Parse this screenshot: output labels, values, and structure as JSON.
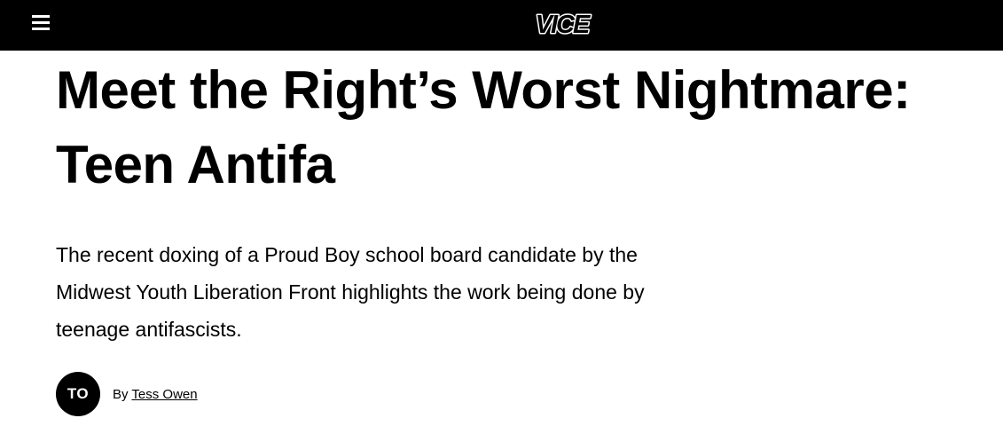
{
  "header": {
    "menu_icon": "hamburger-menu-icon",
    "logo_text": "VICE",
    "background_color": "#000000",
    "foreground_color": "#ffffff"
  },
  "article": {
    "headline_lines": [
      "Meet the Right’s Worst Nightmare:",
      "Teen Antifa"
    ],
    "dek_lines": [
      "The recent doxing of a Proud Boy school board candidate by the",
      "Midwest Youth Liberation Front highlights the work being done by",
      "teenage antifascists."
    ],
    "byline": {
      "avatar_initials": "TO",
      "prefix": "By",
      "author": "Tess Owen"
    }
  }
}
